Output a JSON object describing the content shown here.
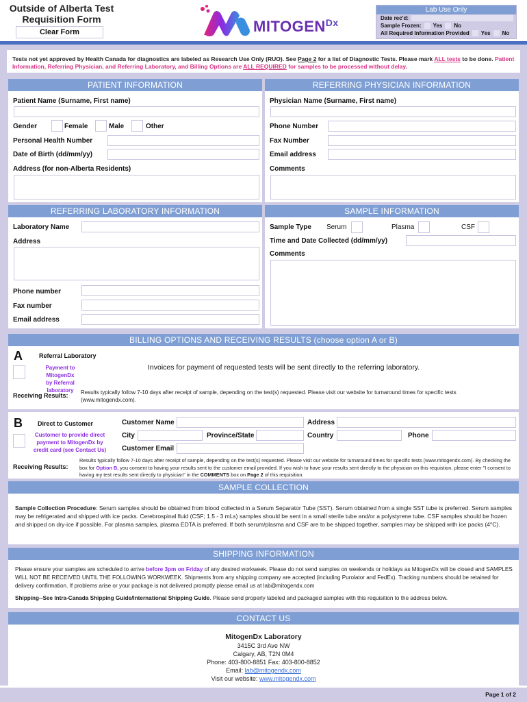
{
  "header": {
    "title_line1": "Outside of Alberta Test",
    "title_line2": "Requisition Form",
    "clear_button": "Clear Form",
    "logo_text": "MITOGEN",
    "logo_sup": "Dx"
  },
  "lab_use": {
    "title": "Lab Use Only",
    "date_received": "Date rec'd:",
    "sample_frozen": "Sample Frozen:",
    "all_info": "All Required Information Provided",
    "yes": "Yes",
    "no": "No"
  },
  "notice": {
    "part1": "Tests not yet approved by Health Canada for diagnostics are labeled as Research Use Only (RUO).  See ",
    "page2": "Page 2",
    "part2": " for a list of Diagnostic Tests.  Please mark ",
    "all_tests": "ALL tests",
    "part3": " to be done.",
    "pink1": "Patient Information, Referring Physician, and Referring Laboratory, and Billing Options are ",
    "all_required": "ALL REQUIRED",
    "pink2": " for samples to be processed without delay."
  },
  "patient": {
    "header": "PATIENT INFORMATION",
    "name_label": "Patient Name (Surname, First name)",
    "gender_label": "Gender",
    "female": "Female",
    "male": "Male",
    "other": "Other",
    "phn_label": "Personal Health Number",
    "dob_label": "Date of Birth (dd/mm/yy)",
    "address_label": "Address (for non-Alberta Residents)"
  },
  "physician": {
    "header": "REFERRING PHYSICIAN INFORMATION",
    "name_label": "Physician Name (Surname, First name)",
    "phone_label": "Phone Number",
    "fax_label": "Fax Number",
    "email_label": "Email address",
    "comments_label": "Comments"
  },
  "laboratory": {
    "header": "REFERRING LABORATORY INFORMATION",
    "name_label": "Laboratory Name",
    "address_label": "Address",
    "phone_label": "Phone number",
    "fax_label": "Fax number",
    "email_label": "Email address"
  },
  "sample": {
    "header": "SAMPLE INFORMATION",
    "type_label": "Sample Type",
    "serum": "Serum",
    "plasma": "Plasma",
    "csf": "CSF",
    "collected_label": "Time and Date Collected (dd/mm/yy)",
    "comments_label": "Comments"
  },
  "billing": {
    "header": "BILLING OPTIONS AND RECEIVING RESULTS (choose option A or B)",
    "a_letter": "A",
    "a_title": "Referral Laboratory",
    "a_payment1": "Payment to MitogenDx",
    "a_payment2": "by Referral laboratory",
    "a_invoice": "Invoices for payment of requested tests will be sent directly to the referring laboratory.",
    "receiving_label": "Receiving Results:",
    "a_results": "Results typically follow 7-10 days after receipt of sample, depending on the test(s) requested. Please visit our website for turnaround times for specific tests (www.mitogendx.com).",
    "b_letter": "B",
    "b_title": "Direct to Customer",
    "b_payment1": "Customer to provide direct",
    "b_payment2": "payment to MitogenDx by",
    "b_payment3": "credit card (see Contact Us)",
    "customer_name": "Customer Name",
    "address": "Address",
    "city": "City",
    "province": "Province/State",
    "country": "Country",
    "phone": "Phone",
    "customer_email": "Customer Email",
    "b_results1": "Results typically follow 7-10 days after receipt of sample, depending on the test(s) requested. Please visit our website for turnaround times for specific tests (www.mitogendx.com).  By checking the box for ",
    "b_option": "Option B,",
    "b_results2": " you consent to having your results sent to the customer email provided.  If you wish to have your results sent directly to the physician on this requistion, please enter \"I consent to having my test results sent directly to physician\" in the ",
    "b_comments": "COMMENTS",
    "b_results3": " box on ",
    "b_page2": "Page 2",
    "b_results4": " of this requisition."
  },
  "collection": {
    "header": "SAMPLE COLLECTION",
    "bold": "Sample Collection Procedure",
    "text": ": Serum samples should be obtained from blood collected in a Serum Separator Tube (SST). Serum obtained from a single SST tube is preferred.  Serum samples may be refrigerated and shipped with ice packs. Cerebrospinal fluid (CSF; 1.5 - 3 mLs) samples should be sent in a small sterile tube and/or a polystyrene tube.  CSF samples should be frozen and shipped on dry-ice if possible.  For plasma samples, plasma EDTA is preferred. If both serum/plasma and CSF are to be shipped together, samples may be shipped with ice packs (4°C)."
  },
  "shipping": {
    "header": "SHIPPING INFORMATION",
    "p1a": "Please ensure your samples are scheduled to arrive ",
    "p1b": "before 3pm on Friday",
    "p1c": " of any desired workweek. Please do not send samples on weekends or holidays as MitogenDx will be closed and SAMPLES WILL NOT BE RECEIVED UNTIL THE FOLLOWING WORKWEEK. Shipments from any shipping company are accepted (including Purolator and FedEx).  Tracking numbers should be retained for delivery confirmation. If problems arise or your package is not delivered promptly please email us at lab@mitogendx.com",
    "p2a": "Shipping--See Intra-Canada Shipping Guide/International Shipping Guide",
    "p2b": ". Please send properly labeled and packaged samples with this requisition to the address below."
  },
  "contact": {
    "header": "CONTACT US",
    "name": "MitogenDx Laboratory",
    "street": "3415C 3rd Ave NW",
    "city": "Calgary, AB, T2N 0M4",
    "phone": "Phone:  403-800-8851  Fax:  403-800-8852",
    "email_label": "Email: ",
    "email": "lab@mitogendx.com",
    "web_label": "Visit our website:  ",
    "web": "www.mitogendx.com"
  },
  "footer": {
    "page": "Page 1 of 2"
  }
}
